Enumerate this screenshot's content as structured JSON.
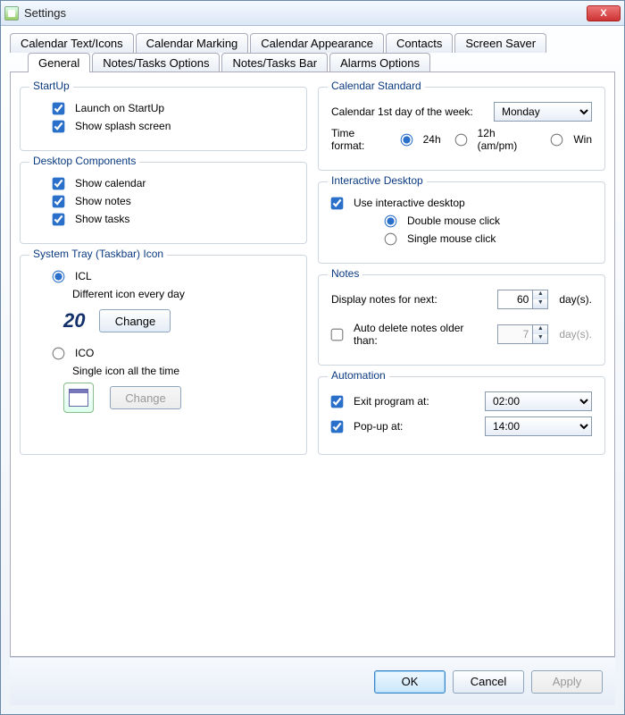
{
  "window": {
    "title": "Settings",
    "close": "X"
  },
  "tabs_top": [
    "Calendar Text/Icons",
    "Calendar Marking",
    "Calendar Appearance",
    "Contacts",
    "Screen Saver"
  ],
  "tabs_bottom": [
    "General",
    "Notes/Tasks Options",
    "Notes/Tasks Bar",
    "Alarms Options"
  ],
  "active_tab": "General",
  "groups": {
    "startup": {
      "title": "StartUp",
      "launch": {
        "label": "Launch on StartUp",
        "checked": true
      },
      "splash": {
        "label": "Show splash screen",
        "checked": true
      }
    },
    "desktop_components": {
      "title": "Desktop Components",
      "calendar": {
        "label": "Show calendar",
        "checked": true
      },
      "notes": {
        "label": "Show notes",
        "checked": true
      },
      "tasks": {
        "label": "Show tasks",
        "checked": true
      }
    },
    "system_tray": {
      "title": "System Tray (Taskbar) Icon",
      "icl": {
        "label": "ICL",
        "sub": "Different icon every day",
        "selected": true,
        "day": "20",
        "change": "Change"
      },
      "ico": {
        "label": "ICO",
        "sub": "Single icon all the time",
        "selected": false,
        "change": "Change",
        "change_enabled": false
      }
    },
    "calendar_standard": {
      "title": "Calendar Standard",
      "first_day_label": "Calendar 1st day of the week:",
      "first_day_value": "Monday",
      "time_format_label": "Time format:",
      "options": {
        "h24": "24h",
        "h12": "12h (am/pm)",
        "win": "Win"
      },
      "selected": "h24"
    },
    "interactive_desktop": {
      "title": "Interactive Desktop",
      "use": {
        "label": "Use interactive desktop",
        "checked": true
      },
      "double": "Double mouse click",
      "single": "Single mouse click",
      "selected": "double"
    },
    "notes": {
      "title": "Notes",
      "display_label": "Display notes for next:",
      "display_value": "60",
      "days_unit": "day(s).",
      "auto_delete": {
        "label": "Auto delete notes older than:",
        "checked": false,
        "value": "7",
        "unit": "day(s)."
      }
    },
    "automation": {
      "title": "Automation",
      "exit": {
        "label": "Exit program at:",
        "checked": true,
        "value": "02:00"
      },
      "popup": {
        "label": "Pop-up at:",
        "checked": true,
        "value": "14:00"
      }
    }
  },
  "footer": {
    "ok": "OK",
    "cancel": "Cancel",
    "apply": "Apply",
    "apply_enabled": false
  }
}
